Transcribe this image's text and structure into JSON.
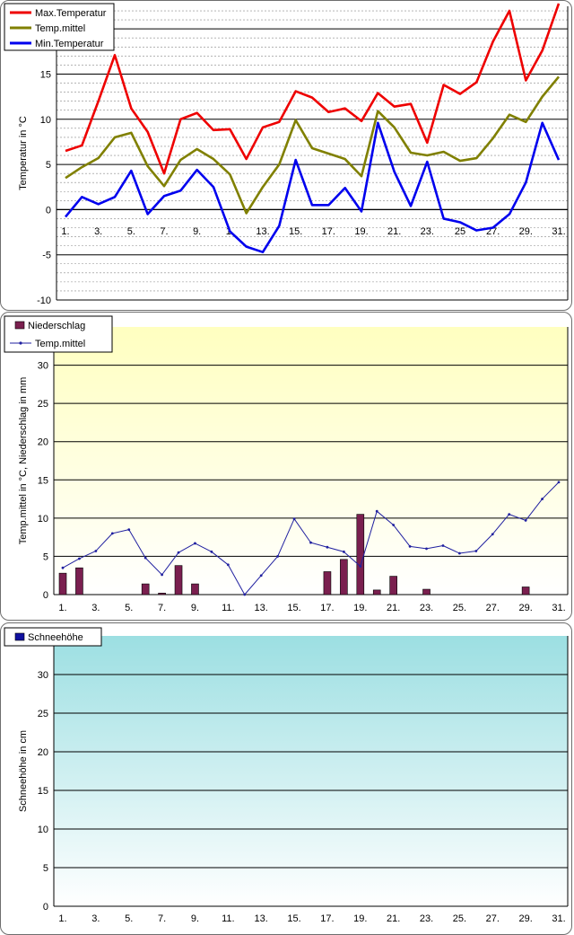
{
  "charts": [
    {
      "id": "temperature",
      "ylabel": "Temperatur  in °C",
      "yticks": [
        -10,
        -5,
        0,
        5,
        10,
        15,
        20
      ],
      "legend": [
        {
          "name": "Max.Temperatur",
          "color": "#ee0000"
        },
        {
          "name": "Temp.mittel",
          "color": "#808000"
        },
        {
          "name": "Min.Temperatur",
          "color": "#0000ee"
        }
      ]
    },
    {
      "id": "precipitation",
      "ylabel": "Temp.mittel  in °C, Niederschlag  in mm",
      "yticks": [
        0,
        5,
        10,
        15,
        20,
        25,
        30
      ],
      "legend": [
        {
          "name": "Niederschlag",
          "color": "#7a1f4f"
        },
        {
          "name": "Temp.mittel",
          "color": "#2020a0"
        }
      ]
    },
    {
      "id": "snow",
      "ylabel": "Schneehöhe  in cm",
      "yticks": [
        0,
        5,
        10,
        15,
        20,
        25,
        30
      ],
      "legend": [
        {
          "name": "Schneehöhe",
          "color": "#1010a0"
        }
      ]
    }
  ],
  "x_tick_labels": [
    "1.",
    "3.",
    "5.",
    "7.",
    "9.",
    "11.",
    "13.",
    "15.",
    "17.",
    "19.",
    "21.",
    "23.",
    "25.",
    "27.",
    "29.",
    "31."
  ],
  "top_chart_x_tick_labels": [
    "1.",
    "3.",
    "5.",
    "7.",
    "9.",
    "1.",
    "13.",
    "15.",
    "17.",
    "19.",
    "21.",
    "23.",
    "25",
    "27.",
    "29.",
    "31."
  ],
  "chart_data": [
    {
      "type": "line",
      "x": [
        1,
        2,
        3,
        4,
        5,
        6,
        7,
        8,
        9,
        10,
        11,
        12,
        13,
        14,
        15,
        16,
        17,
        18,
        19,
        20,
        21,
        22,
        23,
        24,
        25,
        26,
        27,
        28,
        29,
        30,
        31
      ],
      "ylim": [
        -10,
        23
      ],
      "series": [
        {
          "name": "Max.Temperatur",
          "values": [
            6.5,
            7.1,
            12.0,
            17.1,
            11.2,
            8.6,
            4.0,
            10.0,
            10.7,
            8.8,
            8.9,
            5.6,
            9.1,
            9.7,
            13.1,
            12.4,
            10.8,
            11.2,
            9.8,
            12.9,
            11.4,
            11.7,
            7.4,
            13.8,
            12.8,
            14.1,
            18.6,
            22.0,
            14.3,
            17.6,
            22.8
          ]
        },
        {
          "name": "Temp.mittel",
          "values": [
            3.5,
            4.7,
            5.7,
            8.0,
            8.5,
            4.8,
            2.6,
            5.5,
            6.7,
            5.6,
            3.9,
            -0.4,
            2.5,
            5.0,
            9.9,
            6.8,
            6.2,
            5.6,
            3.7,
            10.9,
            9.1,
            6.3,
            6.0,
            6.4,
            5.4,
            5.7,
            7.9,
            10.5,
            9.7,
            12.5,
            14.7
          ]
        },
        {
          "name": "Min.Temperatur",
          "values": [
            -0.8,
            1.4,
            0.6,
            1.4,
            4.3,
            -0.5,
            1.5,
            2.1,
            4.4,
            2.5,
            -2.4,
            -4.1,
            -4.7,
            -1.8,
            5.5,
            0.5,
            0.5,
            2.4,
            -0.2,
            9.6,
            4.2,
            0.4,
            5.3,
            -1.0,
            -1.4,
            -2.3,
            -2.0,
            -0.5,
            3.0,
            9.6,
            5.5
          ]
        }
      ]
    },
    {
      "type": "bar+line",
      "x": [
        1,
        2,
        3,
        4,
        5,
        6,
        7,
        8,
        9,
        10,
        11,
        12,
        13,
        14,
        15,
        16,
        17,
        18,
        19,
        20,
        21,
        22,
        23,
        24,
        25,
        26,
        27,
        28,
        29,
        30,
        31
      ],
      "ylim": [
        0,
        30
      ],
      "series": [
        {
          "name": "Niederschlag",
          "type": "bar",
          "values": [
            2.8,
            3.5,
            0,
            0,
            0,
            1.4,
            0.2,
            3.8,
            1.4,
            0,
            0,
            0,
            0,
            0,
            0,
            0,
            3.0,
            4.6,
            10.5,
            0.6,
            2.4,
            0,
            0.7,
            0,
            0,
            0,
            0,
            0,
            1.0,
            0,
            0
          ]
        },
        {
          "name": "Temp.mittel",
          "type": "line",
          "values": [
            3.5,
            4.7,
            5.7,
            8.0,
            8.5,
            4.8,
            2.6,
            5.5,
            6.7,
            5.6,
            3.9,
            -0.4,
            2.5,
            5.0,
            9.9,
            6.8,
            6.2,
            5.6,
            3.7,
            10.9,
            9.1,
            6.3,
            6.0,
            6.4,
            5.4,
            5.7,
            7.9,
            10.5,
            9.7,
            12.5,
            14.7
          ]
        }
      ]
    },
    {
      "type": "bar",
      "x": [
        1,
        2,
        3,
        4,
        5,
        6,
        7,
        8,
        9,
        10,
        11,
        12,
        13,
        14,
        15,
        16,
        17,
        18,
        19,
        20,
        21,
        22,
        23,
        24,
        25,
        26,
        27,
        28,
        29,
        30,
        31
      ],
      "ylim": [
        0,
        30
      ],
      "series": [
        {
          "name": "Schneehöhe",
          "values": [
            0,
            0,
            0,
            0,
            0,
            0,
            0,
            0,
            0,
            0,
            0,
            0,
            0,
            0,
            0,
            0,
            0,
            0,
            0,
            0,
            0,
            0,
            0,
            0,
            0,
            0,
            0,
            0,
            0,
            0,
            0
          ]
        }
      ]
    }
  ]
}
